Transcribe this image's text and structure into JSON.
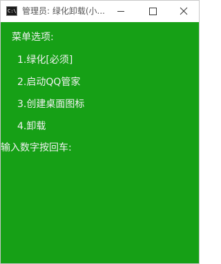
{
  "window": {
    "title": "管理员:  绿化卸载(小...",
    "icon_label": "C:\\",
    "icons": {
      "app": "console-app-icon",
      "minimize": "minimize-icon",
      "maximize": "maximize-icon",
      "close": "close-icon"
    }
  },
  "console": {
    "background": "#16a016",
    "text_color": "#f2f2f2",
    "header": "菜单选项:",
    "options": [
      "1.绿化[必须]",
      "2.启动QQ管家",
      "3.创建桌面图标",
      "4.卸载"
    ],
    "prompt": "输入数字按回车:"
  }
}
